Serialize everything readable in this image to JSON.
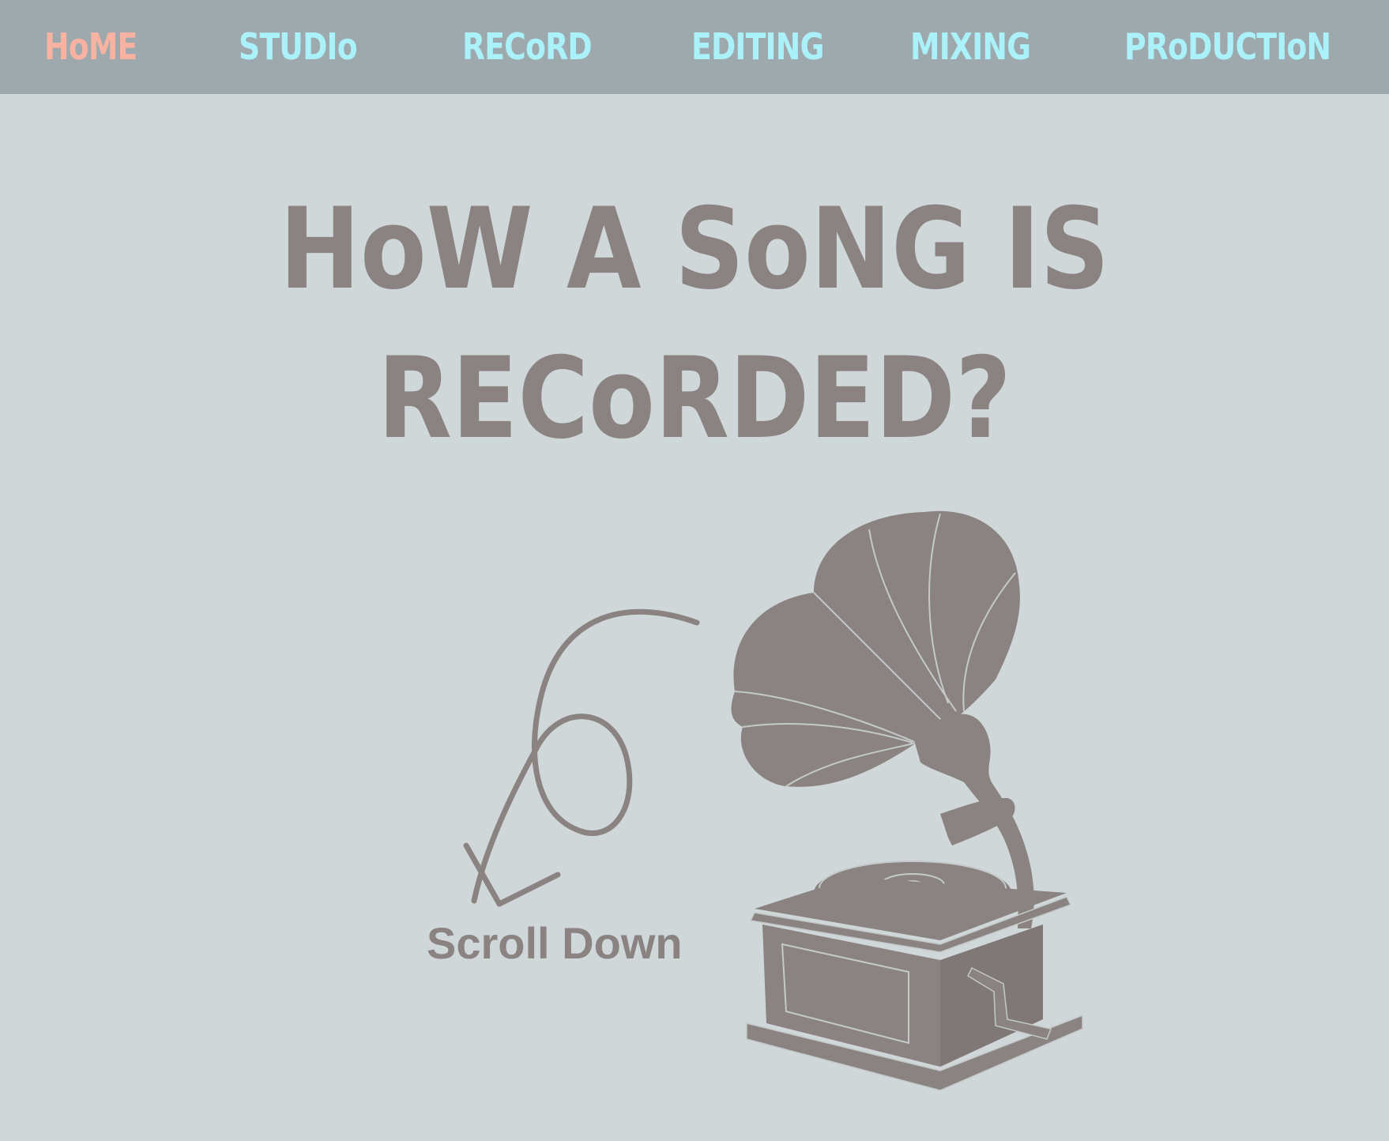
{
  "nav": {
    "items": [
      {
        "label": "HoME",
        "active": true
      },
      {
        "label": "STUDIo",
        "active": false
      },
      {
        "label": "RECoRD",
        "active": false
      },
      {
        "label": "EDITING",
        "active": false
      },
      {
        "label": "MIXING",
        "active": false
      },
      {
        "label": "PRoDUCTIoN",
        "active": false
      }
    ]
  },
  "hero": {
    "title_line_1": "HoW A SoNG IS",
    "title_line_2": "RECoRDED?",
    "scroll_label": "Scroll Down"
  },
  "colors": {
    "page_background": "#cfd7d9",
    "nav_background": "#9ea9ae",
    "nav_link": "#aaf1fa",
    "nav_active": "#f8b2a2",
    "graphic": "#8a8381"
  },
  "icons": {
    "arrow": "curly-down-arrow-icon",
    "gramophone": "gramophone-icon"
  }
}
